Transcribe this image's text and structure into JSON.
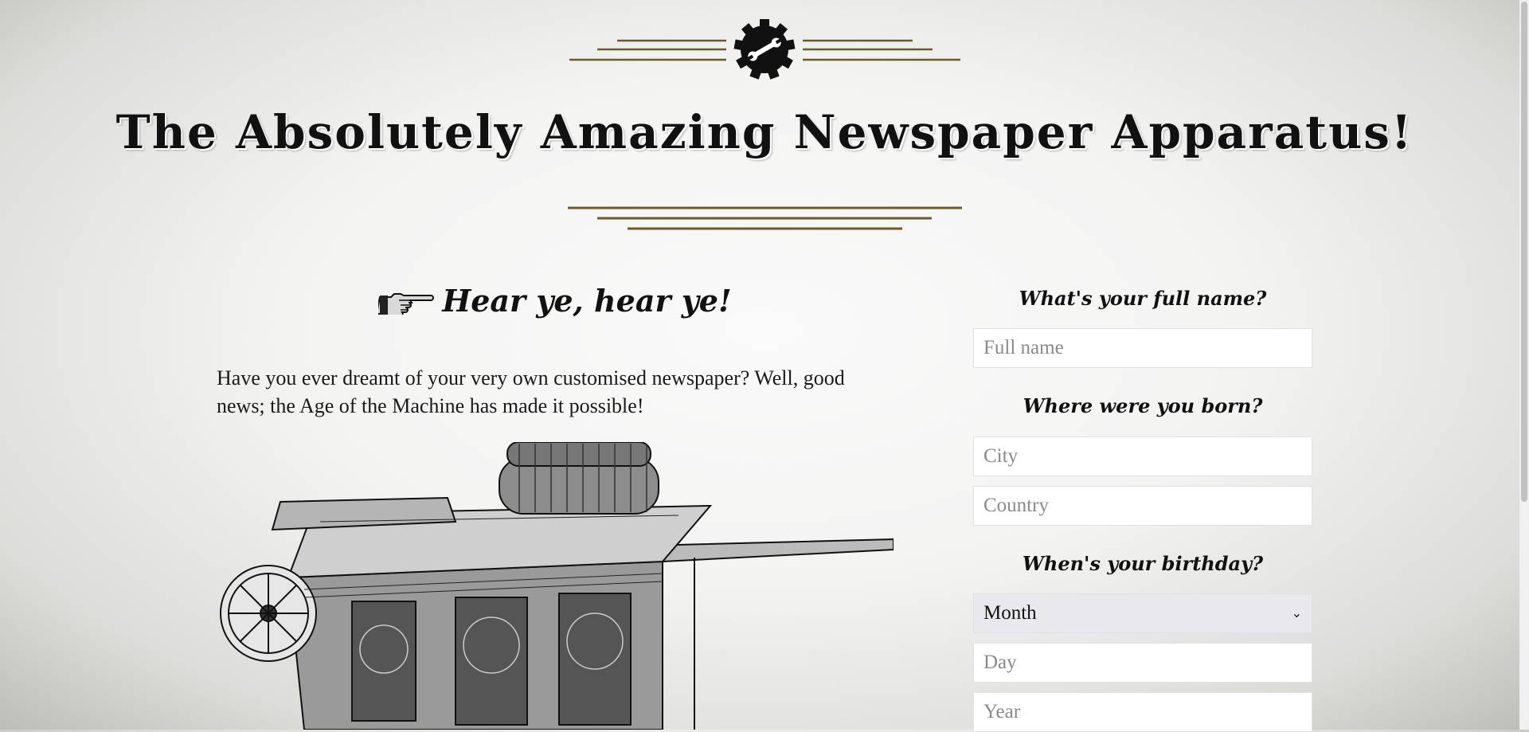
{
  "header": {
    "title": "The Absolutely Amazing Newspaper Apparatus!",
    "emblem_icon": "gear-wrench-icon"
  },
  "intro": {
    "heading": "Hear ye, hear ye!",
    "hand_icon": "pointing-hand-icon",
    "text": "Have you ever dreamt of your very own customised newspaper? Well, good news; the Age of the Machine has made it possible!",
    "image": "printing-press-illustration"
  },
  "form": {
    "name_question": "What's your full name?",
    "name_placeholder": "Full name",
    "born_question": "Where were you born?",
    "city_placeholder": "City",
    "country_placeholder": "Country",
    "birthday_question": "When's your birthday?",
    "month_selected": "Month",
    "day_placeholder": "Day",
    "year_placeholder": "Year"
  },
  "colors": {
    "rule_color": "#6b5a2e",
    "ink": "#111111"
  }
}
